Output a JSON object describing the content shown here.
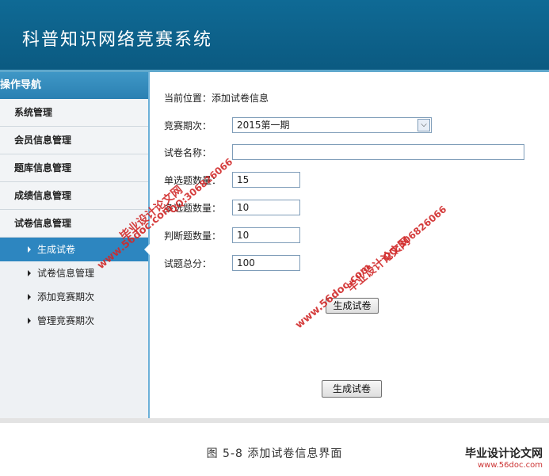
{
  "header": {
    "title": "科普知识网络竞赛系统"
  },
  "sidebar": {
    "title": "操作导航",
    "items": [
      {
        "label": "系统管理"
      },
      {
        "label": "会员信息管理"
      },
      {
        "label": "题库信息管理"
      },
      {
        "label": "成绩信息管理"
      },
      {
        "label": "试卷信息管理"
      }
    ],
    "sub_items": [
      {
        "label": "生成试卷",
        "active": true
      },
      {
        "label": "试卷信息管理"
      },
      {
        "label": "添加竞赛期次"
      },
      {
        "label": "管理竞赛期次"
      }
    ]
  },
  "main": {
    "location_label": "当前位置：添加试卷信息",
    "period": {
      "label": "竞赛期次：",
      "value": "2015第一期"
    },
    "paper_name": {
      "label": "试卷名称：",
      "value": ""
    },
    "single_count": {
      "label": "单选题数量：",
      "value": "15"
    },
    "multi_count": {
      "label": "多选题数量：",
      "value": "10"
    },
    "judge_count": {
      "label": "判断题数量：",
      "value": "10"
    },
    "total_score": {
      "label": "试题总分：",
      "value": "100"
    },
    "generate_btn_label": "生成试卷",
    "generate_btn2_label": "生成试卷"
  },
  "caption": "图 5-8 添加试卷信息界面",
  "watermarks": {
    "cn": "毕业设计论文网",
    "url": "www.56doc.com",
    "qq": "QQ:306826066"
  },
  "corner_logo": {
    "name": "毕业设计论文网",
    "url": "www.56doc.com"
  }
}
